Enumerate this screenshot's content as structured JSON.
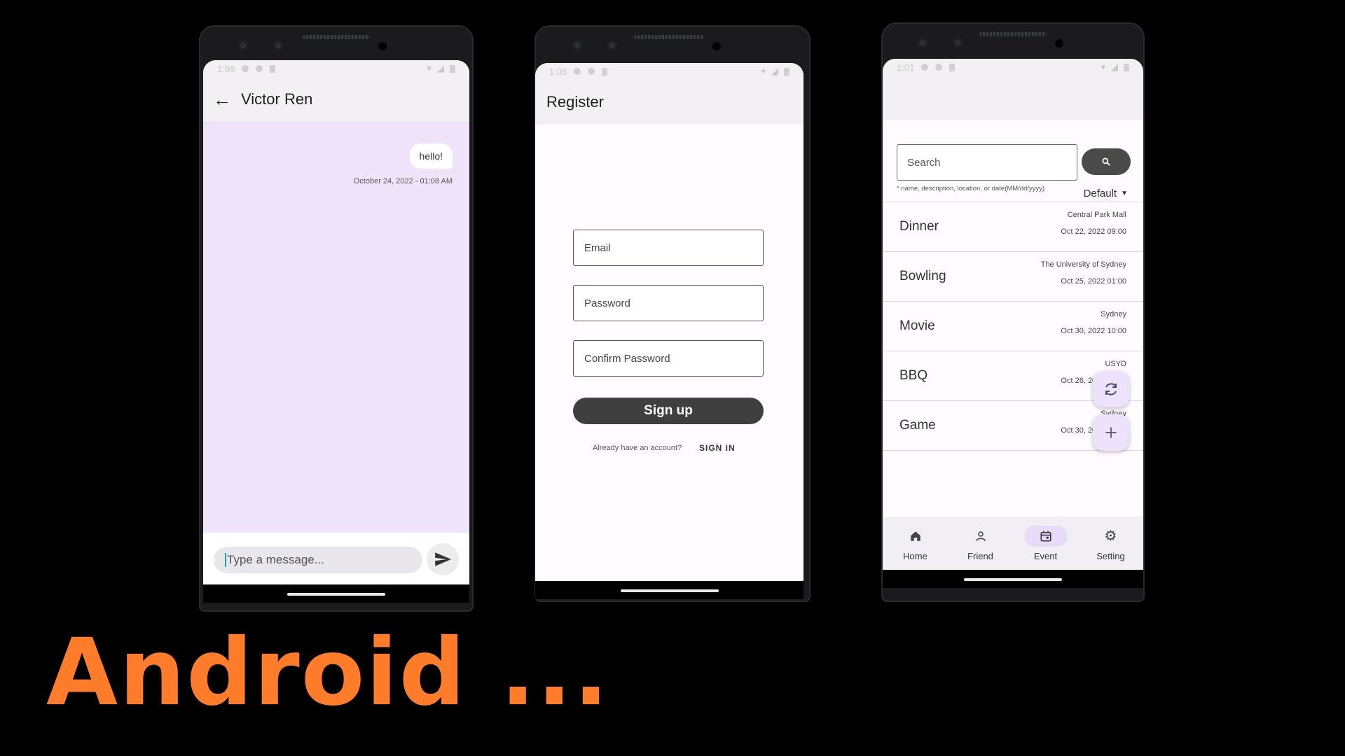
{
  "chat": {
    "status_time": "1:08",
    "title": "Victor Ren",
    "message_text": "hello!",
    "message_time": "October 24, 2022 - 01:08 AM",
    "input_placeholder": "Type a message..."
  },
  "register": {
    "status_time": "1:08",
    "title": "Register",
    "email_label": "Email",
    "password_label": "Password",
    "confirm_password_label": "Confirm Password",
    "signup_label": "Sign up",
    "already_text": "Already have an account?",
    "signin_label": "SIGN IN"
  },
  "events": {
    "status_time": "1:01",
    "search_placeholder": "Search",
    "search_hint": "* name, description, location, or date(MM/dd/yyyy)",
    "sort_label": "Default",
    "items": [
      {
        "name": "Dinner",
        "location": "Central Park Mall",
        "date": "Oct 22, 2022 09:00"
      },
      {
        "name": "Bowling",
        "location": "The University of Sydney",
        "date": "Oct 25, 2022 01:00"
      },
      {
        "name": "Movie",
        "location": "Sydney",
        "date": "Oct 30, 2022 10:00"
      },
      {
        "name": "BBQ",
        "location": "USYD",
        "date": "Oct 26, 2022 05:40"
      },
      {
        "name": "Game",
        "location": "Sydney",
        "date": "Oct 30, 2022 09:30"
      }
    ],
    "nav": {
      "home": "Home",
      "friend": "Friend",
      "event": "Event",
      "setting": "Setting"
    },
    "accent_color": "#e6dcf7"
  },
  "caption": "Android ..."
}
